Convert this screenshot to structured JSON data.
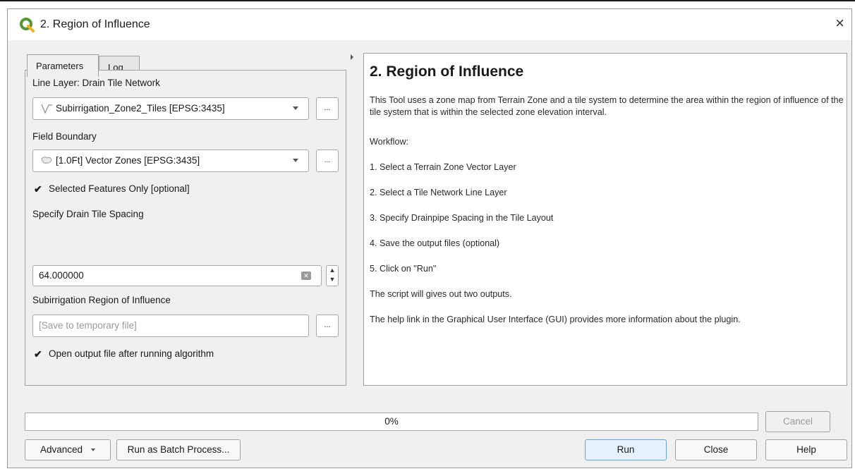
{
  "window": {
    "title": "2. Region of Influence",
    "close_glyph": "×"
  },
  "tabs": [
    {
      "label": "Parameters",
      "active": true
    },
    {
      "label": "Log",
      "active": false
    }
  ],
  "params": {
    "line_layer_label": "Line Layer: Drain Tile Network",
    "line_layer_value": "Subirrigation_Zone2_Tiles [EPSG:3435]",
    "field_boundary_label": "Field Boundary",
    "field_boundary_value": "[1.0Ft] Vector Zones [EPSG:3435]",
    "selected_only_label": "Selected Features Only [optional]",
    "selected_only_checked": true,
    "spacing_label": "Specify Drain Tile Spacing",
    "spacing_value": "64.000000",
    "output_label": "Subirrigation Region of Influence",
    "output_placeholder": "[Save to temporary file]",
    "open_output_label": "Open output file after running algorithm",
    "open_output_checked": true,
    "dots_label": "...",
    "check_glyph": "✔"
  },
  "help": {
    "title": "2. Region of Influence",
    "description": "This Tool uses a zone map from Terrain Zone and a tile system to determine the area within the region of influence of the tile system that is within the selected zone elevation interval.",
    "workflow": "Workflow:",
    "steps": [
      "1. Select a Terrain Zone Vector Layer",
      "2. Select a Tile Network Line Layer",
      "3. Specify Drainpipe Spacing in the Tile Layout",
      "4. Save the output files (optional)",
      "5. Click on \"Run\""
    ],
    "outputs_note": "The script will gives out two outputs.",
    "help_note": "The help link in the Graphical User Interface (GUI) provides more information about the plugin."
  },
  "progress": {
    "label": "0%",
    "value": 0
  },
  "buttons": {
    "cancel": "Cancel",
    "advanced": "Advanced",
    "batch": "Run as Batch Process...",
    "run": "Run",
    "close": "Close",
    "help": "Help"
  },
  "colors": {
    "qgis_green": "#589632",
    "run_border": "#6aa4d6"
  }
}
